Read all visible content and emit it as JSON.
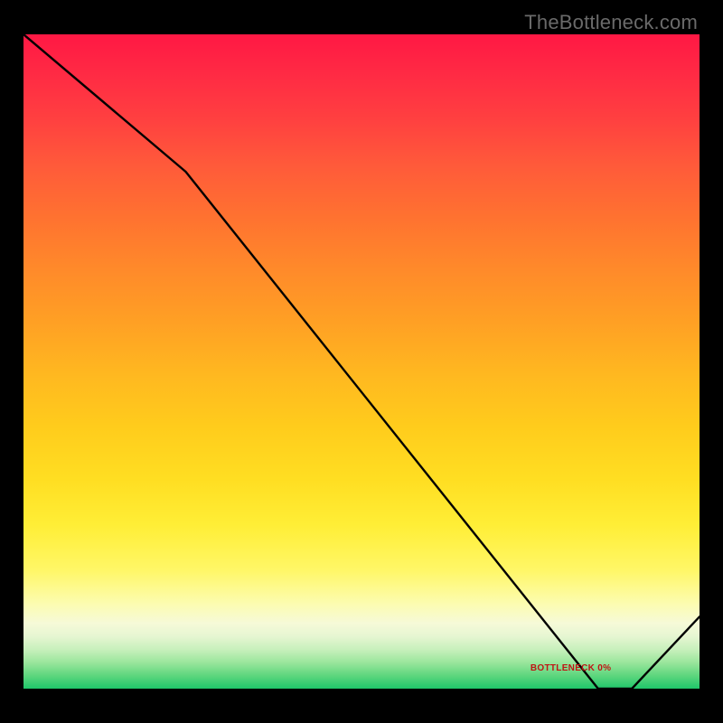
{
  "watermark": "TheBottleneck.com",
  "baseline_label": "BOTTLENECK 0%",
  "colors": {
    "curve": "#000000",
    "label": "#c01414"
  },
  "chart_data": {
    "type": "line",
    "title": "",
    "xlabel": "",
    "ylabel": "",
    "xlim": [
      0,
      100
    ],
    "ylim": [
      0,
      100
    ],
    "annotations": [
      {
        "text": "BOTTLENECK 0%",
        "x": 81,
        "y": 2
      }
    ],
    "series": [
      {
        "name": "bottleneck-curve",
        "x": [
          0,
          24,
          85,
          90,
          100
        ],
        "y": [
          100,
          79,
          0,
          0,
          11
        ]
      }
    ]
  }
}
